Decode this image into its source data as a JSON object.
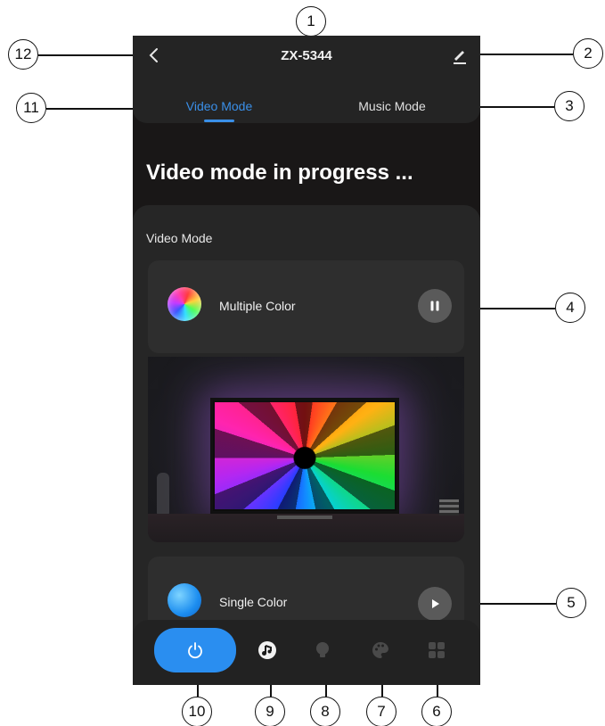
{
  "header": {
    "title": "ZX-5344",
    "tabs": [
      {
        "label": "Video Mode",
        "active": true
      },
      {
        "label": "Music Mode",
        "active": false
      }
    ]
  },
  "main": {
    "status_title": "Video mode in progress ...",
    "panel_label": "Video Mode",
    "modes": [
      {
        "label": "Multiple Color",
        "state": "pause-icon"
      },
      {
        "label": "Single Color",
        "state": "play-icon"
      }
    ]
  },
  "bottom_nav": [
    "power-icon",
    "music-icon",
    "bulb-icon",
    "palette-icon",
    "grid-icon"
  ],
  "callouts": [
    "1",
    "2",
    "3",
    "4",
    "5",
    "6",
    "7",
    "8",
    "9",
    "10",
    "11",
    "12"
  ],
  "colors": {
    "accent": "#2a8ef0",
    "background": "#191717",
    "card": "#2e2e2e"
  }
}
